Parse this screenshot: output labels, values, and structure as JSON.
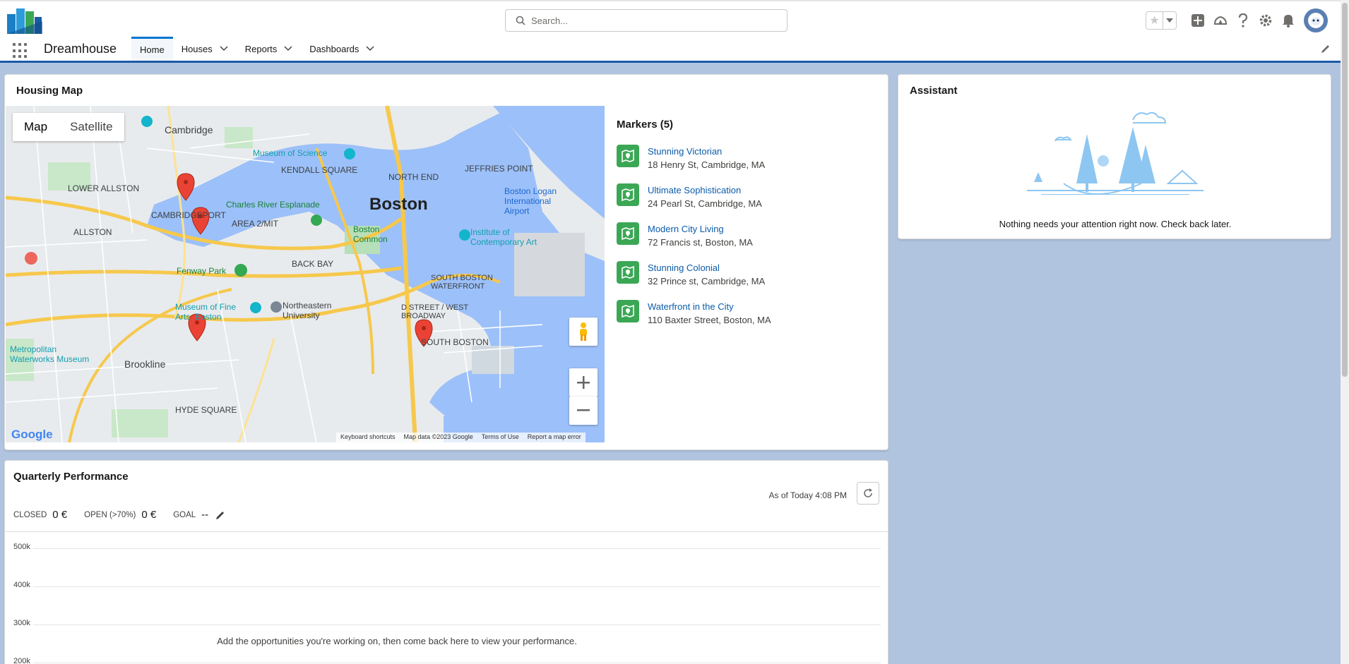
{
  "app": {
    "name": "Dreamhouse"
  },
  "search": {
    "placeholder": "Search..."
  },
  "nav": {
    "tabs": [
      {
        "label": "Home"
      },
      {
        "label": "Houses"
      },
      {
        "label": "Reports"
      },
      {
        "label": "Dashboards"
      }
    ]
  },
  "housing_map": {
    "title": "Housing Map",
    "map_types": [
      "Map",
      "Satellite"
    ],
    "labels": {
      "boston": "Boston",
      "cambridge": "Cambridge",
      "back_bay": "BACK BAY",
      "south_boston": "SOUTH BOSTON",
      "brookline": "Brookline",
      "north_end": "NORTH END",
      "allston": "ALLSTON",
      "lower_allston": "LOWER ALLSTON",
      "kendall": "KENDALL SQUARE",
      "fenway": "Fenway Park",
      "logan": "Boston Logan International Airport",
      "hyde": "HYDE SQUARE",
      "jeffries": "JEFFRIES POINT",
      "museum_sci": "Museum of Science",
      "esplanade": "Charles River Esplanade",
      "common": "Boston Common",
      "ica": "Institute of Contemporary Art",
      "mfa": "Museum of Fine Arts, Boston",
      "northeastern": "Northeastern University",
      "waterfront": "SOUTH BOSTON WATERFRONT",
      "dstreet": "D STREET / WEST BROADWAY",
      "cambridgeport": "CAMBRIDGEPORT",
      "area2": "AREA 2/MIT",
      "metro": "Metropolitan Waterworks Museum"
    },
    "footer": [
      "Keyboard shortcuts",
      "Map data ©2023 Google",
      "Terms of Use",
      "Report a map error"
    ],
    "google": "Google"
  },
  "markers": {
    "title": "Markers (5)",
    "items": [
      {
        "name": "Stunning Victorian",
        "address": "18 Henry St, Cambridge, MA"
      },
      {
        "name": "Ultimate Sophistication",
        "address": "24 Pearl St, Cambridge, MA"
      },
      {
        "name": "Modern City Living",
        "address": "72 Francis st, Boston, MA"
      },
      {
        "name": "Stunning Colonial",
        "address": "32 Prince st, Cambridge, MA"
      },
      {
        "name": "Waterfront in the City",
        "address": "110 Baxter Street, Boston, MA"
      }
    ]
  },
  "assistant": {
    "title": "Assistant",
    "message": "Nothing needs your attention right now. Check back later."
  },
  "performance": {
    "title": "Quarterly Performance",
    "as_of": "As of Today 4:08 PM",
    "stats": [
      {
        "label": "CLOSED",
        "value": "0 €"
      },
      {
        "label": "OPEN (>70%)",
        "value": "0 €"
      },
      {
        "label": "GOAL",
        "value": "--"
      }
    ],
    "y_ticks": [
      "500k",
      "400k",
      "300k",
      "200k"
    ],
    "empty_message": "Add the opportunities you're working on, then come back here to view your performance."
  },
  "colors": {
    "brand_blue": "#1b5aa6",
    "link": "#0b5cab",
    "marker_green": "#3ba755",
    "pin_red": "#ea4335"
  }
}
